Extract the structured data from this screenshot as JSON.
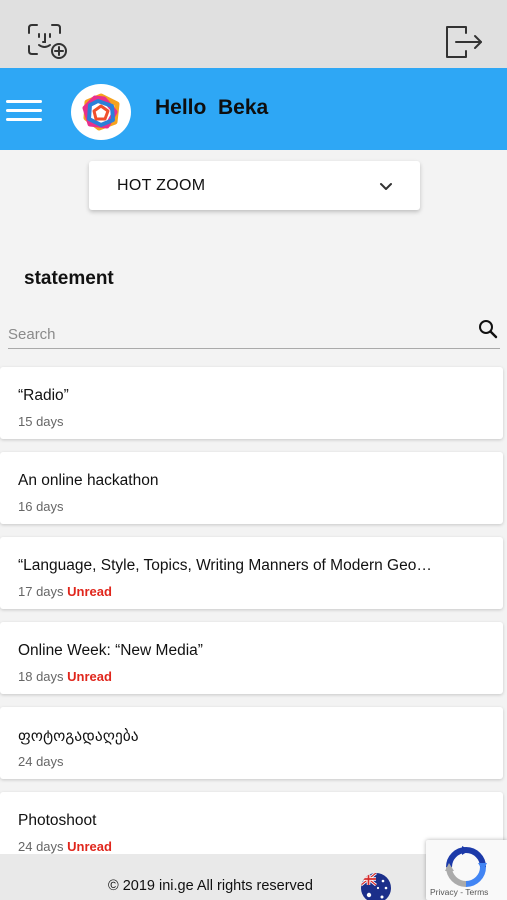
{
  "topbar": {
    "face_icon": "face-id-add-icon",
    "logout_icon": "logout-icon"
  },
  "header": {
    "greeting": "Hello  Beka",
    "menu_icon": "hamburger-icon",
    "logo_icon": "app-logo",
    "background_color": "#2ea7f5"
  },
  "dropdown": {
    "selected": "HOT ZOOM",
    "icon": "chevron-down-icon"
  },
  "section": {
    "title": "statement"
  },
  "search": {
    "placeholder": "Search",
    "value": "",
    "icon": "search-icon"
  },
  "items": [
    {
      "title": "“Radio”",
      "days": "15 days",
      "status": ""
    },
    {
      "title": "An online hackathon",
      "days": "16 days",
      "status": ""
    },
    {
      "title": "“Language, Style, Topics, Writing Manners of Modern Geo…",
      "days": "17 days",
      "status": "Unread"
    },
    {
      "title": "Online Week: “New Media”",
      "days": "18 days",
      "status": "Unread"
    },
    {
      "title": "ფოტოგადაღება",
      "days": "24 days",
      "status": ""
    },
    {
      "title": "Photoshoot",
      "days": "24 days",
      "status": "Unread"
    }
  ],
  "footer": {
    "text": "© 2019 ini.ge All rights reserved",
    "flag_icon": "australia-flag-icon"
  },
  "recaptcha": {
    "links": "Privacy - Terms"
  },
  "colors": {
    "accent": "#2ea7f5",
    "unread": "#e0261c"
  }
}
